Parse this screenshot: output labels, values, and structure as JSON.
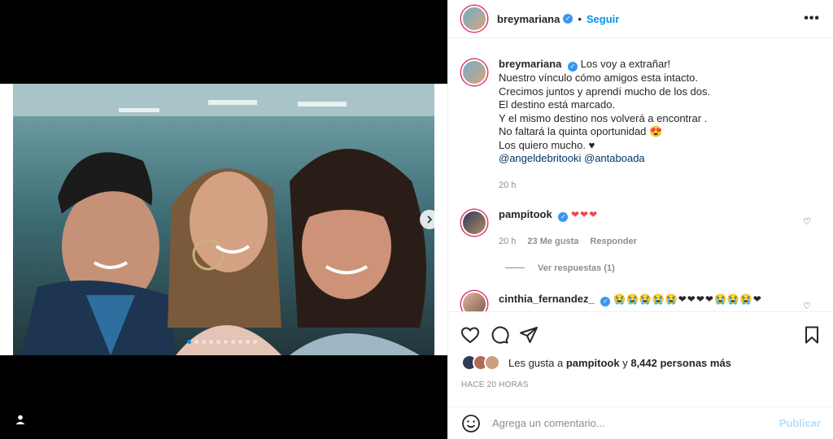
{
  "post": {
    "author": "breymariana",
    "follow_label": "Seguir",
    "separator": "•",
    "more_icon": "more-horizontal-icon",
    "caption_lines": [
      "Los voy a extrañar!",
      "Nuestro vínculo cómo amigos esta intacto.",
      "Crecimos juntos y aprendí mucho de los dos.",
      "El destino está marcado.",
      "Y el mismo destino nos volverá a encontrar .",
      "No faltará la quinta oportunidad 😍",
      "Los quiero mucho. ♥"
    ],
    "mentions": [
      "@angeldebritooki",
      "@antaboada"
    ],
    "caption_time": "20 h"
  },
  "comments": [
    {
      "user": "pampitook",
      "text": "❤❤❤",
      "time": "20 h",
      "likes": "23 Me gusta",
      "reply_label": "Responder",
      "view_replies": "Ver respuestas (1)"
    },
    {
      "user": "cinthia_fernandez_",
      "text": "😭😭😭😭😭❤❤❤❤😭😭😭❤"
    }
  ],
  "likes": {
    "prefix": "Les gusta a",
    "user": "pampitook",
    "connector": "y",
    "count": "8,442 personas más"
  },
  "timestamp": "HACE 20 HORAS",
  "add_comment": {
    "placeholder": "Agrega un comentario...",
    "publish_label": "Publicar"
  },
  "carousel": {
    "total": 10,
    "active": 0
  },
  "colors": {
    "accent": "#0095f6",
    "verified": "#3897f0",
    "heart": "#ed4956"
  }
}
